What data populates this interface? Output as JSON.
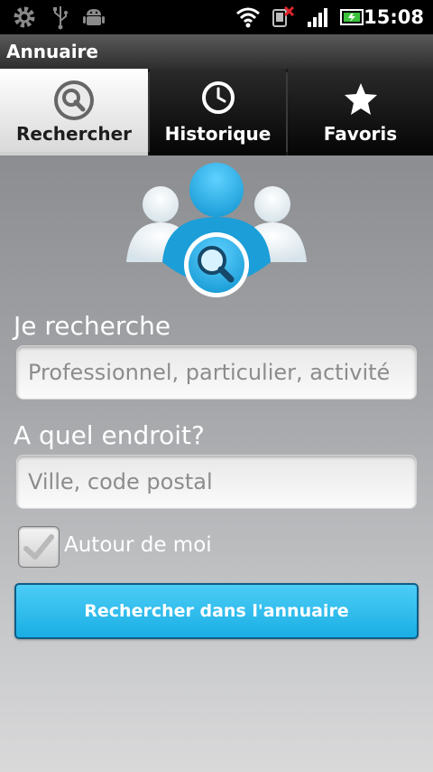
{
  "status_bar": {
    "time": "15:08",
    "icons": [
      "settings-icon",
      "usb-icon",
      "android-debug-icon",
      "wifi-icon",
      "sync-error-icon",
      "signal-icon",
      "battery-icon"
    ]
  },
  "app": {
    "title": "Annuaire"
  },
  "tabs": [
    {
      "label": "Rechercher",
      "icon": "search-icon",
      "active": true
    },
    {
      "label": "Historique",
      "icon": "clock-icon",
      "active": false
    },
    {
      "label": "Favoris",
      "icon": "star-icon",
      "active": false
    }
  ],
  "form": {
    "search_label": "Je recherche",
    "search_placeholder": "Professionnel, particulier, activité",
    "search_value": "",
    "location_label": "A quel endroit?",
    "location_placeholder": "Ville, code postal",
    "location_value": "",
    "nearby_label": "Autour de moi",
    "nearby_checked": true,
    "submit_label": "Rechercher dans l'annuaire"
  },
  "colors": {
    "accent": "#29bcee",
    "accent_border": "#0f5d86",
    "logo_blue": "#1c9ed8"
  }
}
